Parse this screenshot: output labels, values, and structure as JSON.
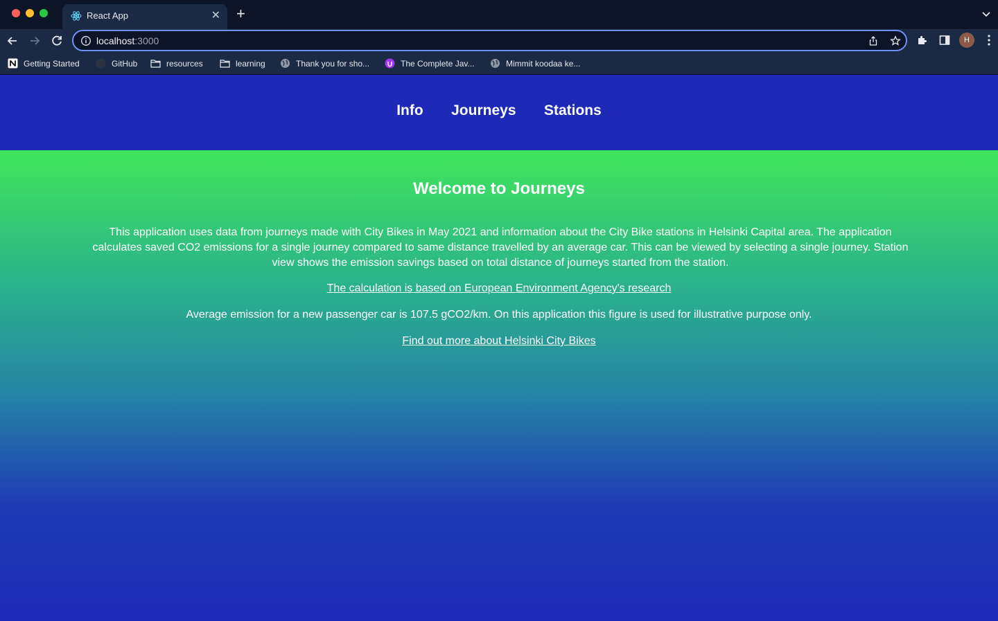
{
  "browser": {
    "tab_title": "React App",
    "url_host": "localhost",
    "url_port": ":3000",
    "avatar_initial": "H",
    "bookmarks": [
      {
        "label": "Getting Started",
        "icon": "notion-icon"
      },
      {
        "label": "GitHub",
        "icon": "github-icon"
      },
      {
        "label": "resources",
        "icon": "folder-icon"
      },
      {
        "label": "learning",
        "icon": "folder-icon"
      },
      {
        "label": "Thank you for sho...",
        "icon": "globe-icon"
      },
      {
        "label": "The Complete Jav...",
        "icon": "udemy-icon"
      },
      {
        "label": "Mimmit koodaa ke...",
        "icon": "globe-icon"
      }
    ]
  },
  "nav": {
    "items": [
      "Info",
      "Journeys",
      "Stations"
    ]
  },
  "hero": {
    "title": "Welcome to Journeys",
    "description": "This application uses data from journeys made with City Bikes in May 2021 and information about the City Bike stations in Helsinki Capital area. The application calculates saved CO2 emissions for a single journey compared to same distance travelled by an average car. This can be viewed by selecting a single journey. Station view shows the emission savings based on total distance of journeys started from the station.",
    "research_link": "The calculation is based on European Environment Agency's research",
    "average_text": "Average emission for a new passenger car is 107.5 gCO2/km. On this application this figure is used for illustrative purpose only.",
    "citybikes_link": "Find out more about Helsinki City Bikes"
  },
  "colors": {
    "header_bg": "#1e29b8",
    "gradient_top": "#40e55b",
    "gradient_bottom": "#1e29b8"
  }
}
